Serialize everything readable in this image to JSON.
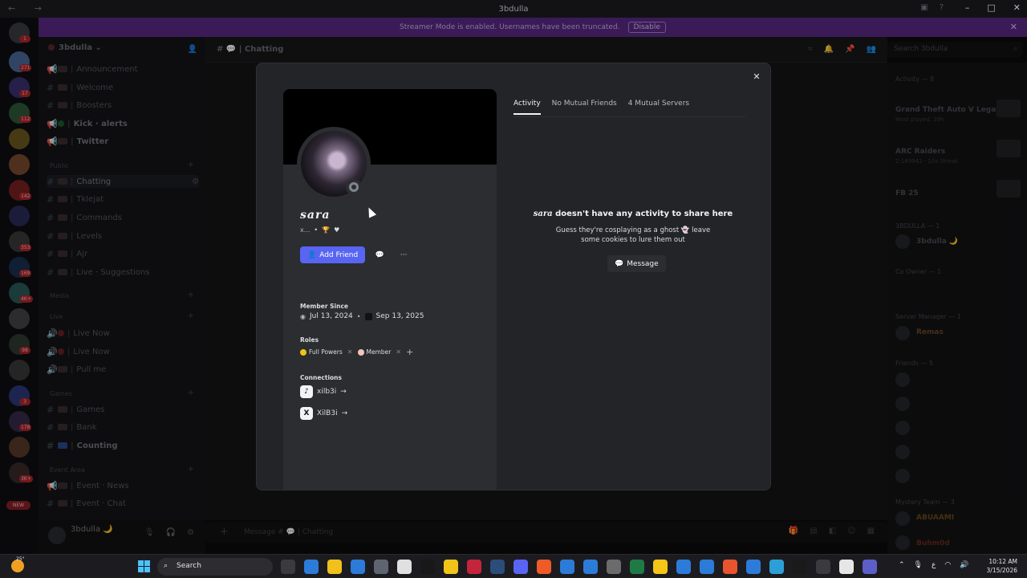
{
  "window": {
    "title": "3bdulla",
    "nav_arrows": "← →"
  },
  "banner": {
    "text": "Streamer Mode is enabled. Usernames have been truncated.",
    "button": "Disable",
    "close": "✕"
  },
  "rail": {
    "badges": [
      "1",
      "271",
      "17",
      "112",
      "142",
      "353",
      "169",
      "4K+",
      "98",
      "3",
      "178",
      "3K+"
    ],
    "new_label": "NEW"
  },
  "server": {
    "name": "3bdulla",
    "channels": [
      {
        "label": "Announcement"
      },
      {
        "label": "Welcome"
      },
      {
        "label": "Boosters"
      },
      {
        "label": "Kick · alerts"
      },
      {
        "label": "Twitter"
      }
    ],
    "cat_public": "Public",
    "public_channels": [
      {
        "label": "Chatting"
      },
      {
        "label": "Tklejat"
      },
      {
        "label": "Commands"
      },
      {
        "label": "Levels"
      },
      {
        "label": "Ajr"
      },
      {
        "label": "Live · Suggestions"
      }
    ],
    "cat_media": "Media",
    "cat_live": "Live",
    "live_channels": [
      {
        "label": "Live Now"
      },
      {
        "label": "Live Now"
      },
      {
        "label": "Pull me"
      }
    ],
    "cat_games": "Games",
    "games_channels": [
      {
        "label": "Games"
      },
      {
        "label": "Bank"
      },
      {
        "label": "Counting"
      }
    ],
    "cat_event": "Event Area",
    "event_channels": [
      {
        "label": "Event · News"
      },
      {
        "label": "Event · Chat"
      }
    ]
  },
  "user": {
    "name": "3bdulla 🌙"
  },
  "chat": {
    "title": "Chatting",
    "search_placeholder": "Search 3bdulla",
    "input_placeholder": "Message #",
    "input_channel": "Chatting"
  },
  "members": {
    "activity_header": "Activity — 8",
    "activities": [
      {
        "name": "Grand Theft Auto V Legacy",
        "sub": "Most played: 29h"
      },
      {
        "name": "ARC Raiders",
        "sub": "2:189942 · 10x Streak"
      },
      {
        "name": "FB 25",
        "sub": ""
      }
    ],
    "groups": [
      {
        "header": "3BDULLA — 1",
        "members": [
          "3bdulla 🌙"
        ]
      },
      {
        "header": "Co Owner — 1",
        "members": []
      },
      {
        "header": "Server Manager — 1",
        "members": [
          "Remas"
        ]
      },
      {
        "header": "Friends — 5",
        "members": []
      },
      {
        "header": "Mystery Team — 3",
        "members": [
          "ABUAAMI",
          "Buhm0d"
        ]
      }
    ]
  },
  "profile": {
    "display_name": "sara",
    "username": "x...",
    "add_friend": "Add Friend",
    "more": "···",
    "member_since_label": "Member Since",
    "discord_since": "Jul 13, 2024",
    "server_since": "Sep 13, 2025",
    "roles_label": "Roles",
    "roles": [
      {
        "name": "Full Powers",
        "color": "#f0c419"
      },
      {
        "name": "Member",
        "color": "#f3c7b5"
      }
    ],
    "connections_label": "Connections",
    "connections": [
      {
        "name": "xilb3i",
        "icon": "tiktok-icon"
      },
      {
        "name": "XilB3i",
        "icon": "x-icon"
      }
    ],
    "tabs": [
      "Activity",
      "No Mutual Friends",
      "4 Mutual Servers"
    ],
    "empty_title_suffix": "doesn't have any activity to share here",
    "empty_sub": "Guess they're cosplaying as a ghost 👻 leave some cookies to lure them out",
    "message_button": "Message",
    "close": "✕"
  },
  "taskbar": {
    "weather": "25°",
    "search": "Search",
    "time": "10:12 AM",
    "date": "3/15/2026",
    "app_colors": [
      "#3a3a3f",
      "#2d7bd8",
      "#f2c01b",
      "#2d7bd8",
      "#5e6570",
      "#e0e0e0",
      "#181818",
      "#f0c419",
      "#c4253a",
      "#2a4d7a",
      "#5865f2",
      "#ef5a29",
      "#2d7bd8",
      "#2d7bd8",
      "#6b6b6b",
      "#1f7a45",
      "#f5c518",
      "#2d7bd8",
      "#2d7bd8",
      "#e8542f",
      "#2d7bd8",
      "#2d9fd8",
      "#1a1a1a",
      "#3a3a3f",
      "#e6e6e6",
      "#5b5fc7"
    ]
  }
}
